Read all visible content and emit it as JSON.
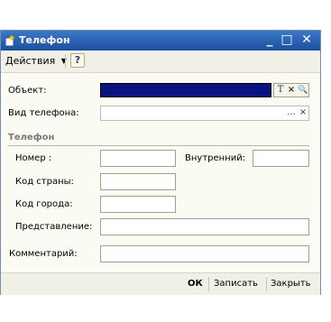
{
  "window": {
    "title": "Телефон"
  },
  "titlebar": {
    "minimize": "_",
    "maximize": "□",
    "close": "✕"
  },
  "toolbar": {
    "actions_label": "Действия",
    "help_label": "?"
  },
  "form": {
    "object_label": "Объект:",
    "object_value": "",
    "object_btn_t": "T",
    "object_btn_clear": "×",
    "object_btn_search": "🔍",
    "phone_type_label": "Вид телефона:",
    "phone_type_value": "",
    "phone_type_btn_select": "...",
    "phone_type_btn_clear": "×",
    "group_phone": "Телефон",
    "number_label": "Номер :",
    "number_value": "",
    "internal_label": "Внутренний:",
    "internal_value": "",
    "country_code_label": "Код страны:",
    "country_code_value": "",
    "city_code_label": "Код города:",
    "city_code_value": "",
    "representation_label": "Представление:",
    "representation_value": "",
    "comment_label": "Комментарий:",
    "comment_value": ""
  },
  "footer": {
    "ok_label": "ОК",
    "save_label": "Записать",
    "close_label": "Закрыть"
  }
}
